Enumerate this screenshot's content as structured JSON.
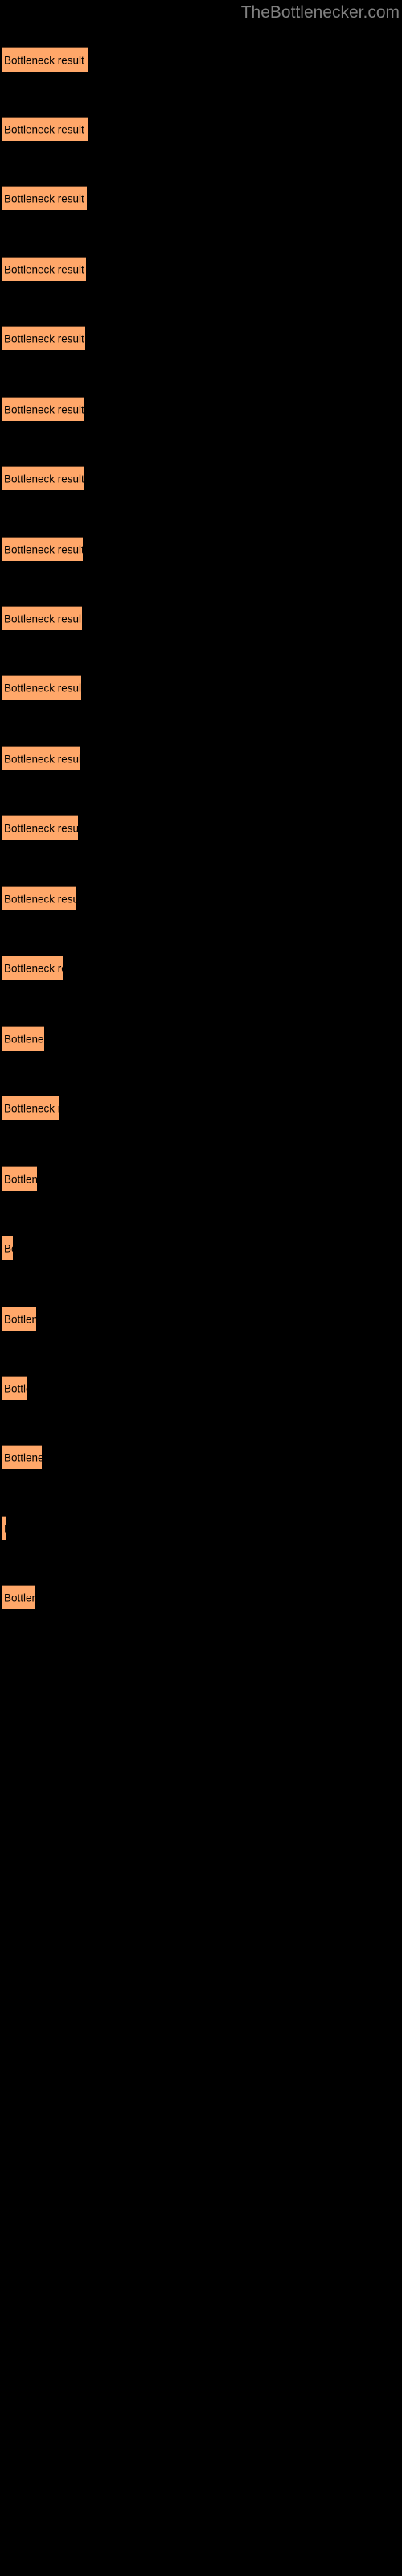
{
  "header": {
    "site_title": "TheBottlenecker.com",
    "title_color": "#808080"
  },
  "theme": {
    "background": "#000000",
    "bar_color": "#ffa769",
    "bar_border": "#5c3a22",
    "label_color": "#000000"
  },
  "chart_data": {
    "type": "bar",
    "orientation": "horizontal",
    "title": "",
    "subtitle": "",
    "xlabel": "",
    "ylabel": "",
    "grid": false,
    "legend": null,
    "axis_visible": false,
    "bar_label_text": "Bottleneck result",
    "categories": [
      "Bottleneck result",
      "Bottleneck result",
      "Bottleneck result",
      "Bottleneck result",
      "Bottleneck result",
      "Bottleneck result",
      "Bottleneck result",
      "Bottleneck result",
      "Bottleneck result",
      "Bottleneck result",
      "Bottleneck result",
      "Bottleneck result",
      "Bottleneck result",
      "Bottleneck result",
      "Bottleneck result",
      "Bottleneck result",
      "Bottleneck result",
      "Bottleneck result",
      "Bottleneck result",
      "Bottleneck result",
      "Bottleneck result",
      "Bottleneck result"
    ],
    "values": [
      108,
      106,
      104,
      103,
      102,
      101,
      100,
      99,
      98,
      97,
      96,
      95,
      93,
      76,
      53,
      71,
      44,
      14,
      43,
      32,
      50,
      5,
      41
    ],
    "xlim": [
      0,
      500
    ],
    "bars": [
      {
        "y": 58,
        "width": 108,
        "label": "Bottleneck result"
      },
      {
        "y": 101,
        "width": 107,
        "label": "Bottleneck result"
      },
      {
        "y": 144,
        "width": 106,
        "label": "Bottleneck result"
      },
      {
        "y": 188,
        "width": 105,
        "label": "Bottleneck result"
      },
      {
        "y": 231,
        "width": 104,
        "label": "Bottleneck result"
      },
      {
        "y": 275,
        "width": 103,
        "label": "Bottleneck result"
      },
      {
        "y": 318,
        "width": 102,
        "label": "Bottleneck result"
      },
      {
        "y": 362,
        "width": 101,
        "label": "Bottleneck result"
      },
      {
        "y": 405,
        "width": 100,
        "label": "Bottleneck result"
      },
      {
        "y": 448,
        "width": 99,
        "label": "Bottleneck result"
      },
      {
        "y": 492,
        "width": 98,
        "label": "Bottleneck result"
      },
      {
        "y": 535,
        "width": 95,
        "label": "Bottleneck result"
      },
      {
        "y": 579,
        "width": 92,
        "label": "Bottleneck result"
      },
      {
        "y": 622,
        "width": 76,
        "label": "Bottleneck result"
      },
      {
        "y": 666,
        "width": 53,
        "label": "Bottleneck result"
      },
      {
        "y": 709,
        "width": 71,
        "label": "Bottleneck result"
      },
      {
        "y": 753,
        "width": 44,
        "label": "Bottleneck result"
      },
      {
        "y": 796,
        "width": 14,
        "label": "Bottleneck result"
      },
      {
        "y": 840,
        "width": 43,
        "label": "Bottleneck result"
      },
      {
        "y": 883,
        "width": 32,
        "label": "Bottleneck result"
      },
      {
        "y": 926,
        "width": 50,
        "label": "Bottleneck result"
      },
      {
        "y": 970,
        "width": 5,
        "label": "Bottleneck result"
      },
      {
        "y": 1013,
        "width": 41,
        "label": "Bottleneck result"
      }
    ]
  }
}
